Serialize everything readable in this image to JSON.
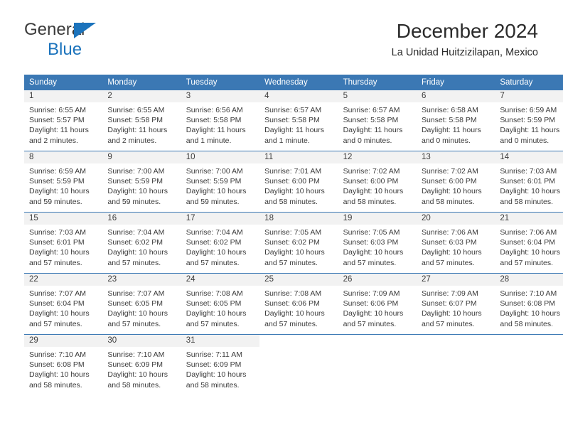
{
  "brand": {
    "general": "General",
    "blue": "Blue",
    "triangle_color": "#1b73bc"
  },
  "header": {
    "title": "December 2024",
    "subtitle": "La Unidad Huitzizilapan, Mexico"
  },
  "theme": {
    "header_bg": "#3b78b4",
    "header_text": "#ffffff",
    "daynum_bg": "#f2f2f2",
    "grid_line": "#3b78b4"
  },
  "calendar": {
    "weekday_headers": [
      "Sunday",
      "Monday",
      "Tuesday",
      "Wednesday",
      "Thursday",
      "Friday",
      "Saturday"
    ],
    "weeks": [
      [
        {
          "day": "1",
          "sunrise": "Sunrise: 6:55 AM",
          "sunset": "Sunset: 5:57 PM",
          "daylight": "Daylight: 11 hours and 2 minutes."
        },
        {
          "day": "2",
          "sunrise": "Sunrise: 6:55 AM",
          "sunset": "Sunset: 5:58 PM",
          "daylight": "Daylight: 11 hours and 2 minutes."
        },
        {
          "day": "3",
          "sunrise": "Sunrise: 6:56 AM",
          "sunset": "Sunset: 5:58 PM",
          "daylight": "Daylight: 11 hours and 1 minute."
        },
        {
          "day": "4",
          "sunrise": "Sunrise: 6:57 AM",
          "sunset": "Sunset: 5:58 PM",
          "daylight": "Daylight: 11 hours and 1 minute."
        },
        {
          "day": "5",
          "sunrise": "Sunrise: 6:57 AM",
          "sunset": "Sunset: 5:58 PM",
          "daylight": "Daylight: 11 hours and 0 minutes."
        },
        {
          "day": "6",
          "sunrise": "Sunrise: 6:58 AM",
          "sunset": "Sunset: 5:58 PM",
          "daylight": "Daylight: 11 hours and 0 minutes."
        },
        {
          "day": "7",
          "sunrise": "Sunrise: 6:59 AM",
          "sunset": "Sunset: 5:59 PM",
          "daylight": "Daylight: 11 hours and 0 minutes."
        }
      ],
      [
        {
          "day": "8",
          "sunrise": "Sunrise: 6:59 AM",
          "sunset": "Sunset: 5:59 PM",
          "daylight": "Daylight: 10 hours and 59 minutes."
        },
        {
          "day": "9",
          "sunrise": "Sunrise: 7:00 AM",
          "sunset": "Sunset: 5:59 PM",
          "daylight": "Daylight: 10 hours and 59 minutes."
        },
        {
          "day": "10",
          "sunrise": "Sunrise: 7:00 AM",
          "sunset": "Sunset: 5:59 PM",
          "daylight": "Daylight: 10 hours and 59 minutes."
        },
        {
          "day": "11",
          "sunrise": "Sunrise: 7:01 AM",
          "sunset": "Sunset: 6:00 PM",
          "daylight": "Daylight: 10 hours and 58 minutes."
        },
        {
          "day": "12",
          "sunrise": "Sunrise: 7:02 AM",
          "sunset": "Sunset: 6:00 PM",
          "daylight": "Daylight: 10 hours and 58 minutes."
        },
        {
          "day": "13",
          "sunrise": "Sunrise: 7:02 AM",
          "sunset": "Sunset: 6:00 PM",
          "daylight": "Daylight: 10 hours and 58 minutes."
        },
        {
          "day": "14",
          "sunrise": "Sunrise: 7:03 AM",
          "sunset": "Sunset: 6:01 PM",
          "daylight": "Daylight: 10 hours and 58 minutes."
        }
      ],
      [
        {
          "day": "15",
          "sunrise": "Sunrise: 7:03 AM",
          "sunset": "Sunset: 6:01 PM",
          "daylight": "Daylight: 10 hours and 57 minutes."
        },
        {
          "day": "16",
          "sunrise": "Sunrise: 7:04 AM",
          "sunset": "Sunset: 6:02 PM",
          "daylight": "Daylight: 10 hours and 57 minutes."
        },
        {
          "day": "17",
          "sunrise": "Sunrise: 7:04 AM",
          "sunset": "Sunset: 6:02 PM",
          "daylight": "Daylight: 10 hours and 57 minutes."
        },
        {
          "day": "18",
          "sunrise": "Sunrise: 7:05 AM",
          "sunset": "Sunset: 6:02 PM",
          "daylight": "Daylight: 10 hours and 57 minutes."
        },
        {
          "day": "19",
          "sunrise": "Sunrise: 7:05 AM",
          "sunset": "Sunset: 6:03 PM",
          "daylight": "Daylight: 10 hours and 57 minutes."
        },
        {
          "day": "20",
          "sunrise": "Sunrise: 7:06 AM",
          "sunset": "Sunset: 6:03 PM",
          "daylight": "Daylight: 10 hours and 57 minutes."
        },
        {
          "day": "21",
          "sunrise": "Sunrise: 7:06 AM",
          "sunset": "Sunset: 6:04 PM",
          "daylight": "Daylight: 10 hours and 57 minutes."
        }
      ],
      [
        {
          "day": "22",
          "sunrise": "Sunrise: 7:07 AM",
          "sunset": "Sunset: 6:04 PM",
          "daylight": "Daylight: 10 hours and 57 minutes."
        },
        {
          "day": "23",
          "sunrise": "Sunrise: 7:07 AM",
          "sunset": "Sunset: 6:05 PM",
          "daylight": "Daylight: 10 hours and 57 minutes."
        },
        {
          "day": "24",
          "sunrise": "Sunrise: 7:08 AM",
          "sunset": "Sunset: 6:05 PM",
          "daylight": "Daylight: 10 hours and 57 minutes."
        },
        {
          "day": "25",
          "sunrise": "Sunrise: 7:08 AM",
          "sunset": "Sunset: 6:06 PM",
          "daylight": "Daylight: 10 hours and 57 minutes."
        },
        {
          "day": "26",
          "sunrise": "Sunrise: 7:09 AM",
          "sunset": "Sunset: 6:06 PM",
          "daylight": "Daylight: 10 hours and 57 minutes."
        },
        {
          "day": "27",
          "sunrise": "Sunrise: 7:09 AM",
          "sunset": "Sunset: 6:07 PM",
          "daylight": "Daylight: 10 hours and 57 minutes."
        },
        {
          "day": "28",
          "sunrise": "Sunrise: 7:10 AM",
          "sunset": "Sunset: 6:08 PM",
          "daylight": "Daylight: 10 hours and 58 minutes."
        }
      ],
      [
        {
          "day": "29",
          "sunrise": "Sunrise: 7:10 AM",
          "sunset": "Sunset: 6:08 PM",
          "daylight": "Daylight: 10 hours and 58 minutes."
        },
        {
          "day": "30",
          "sunrise": "Sunrise: 7:10 AM",
          "sunset": "Sunset: 6:09 PM",
          "daylight": "Daylight: 10 hours and 58 minutes."
        },
        {
          "day": "31",
          "sunrise": "Sunrise: 7:11 AM",
          "sunset": "Sunset: 6:09 PM",
          "daylight": "Daylight: 10 hours and 58 minutes."
        },
        {
          "day": "",
          "sunrise": "",
          "sunset": "",
          "daylight": ""
        },
        {
          "day": "",
          "sunrise": "",
          "sunset": "",
          "daylight": ""
        },
        {
          "day": "",
          "sunrise": "",
          "sunset": "",
          "daylight": ""
        },
        {
          "day": "",
          "sunrise": "",
          "sunset": "",
          "daylight": ""
        }
      ]
    ]
  }
}
